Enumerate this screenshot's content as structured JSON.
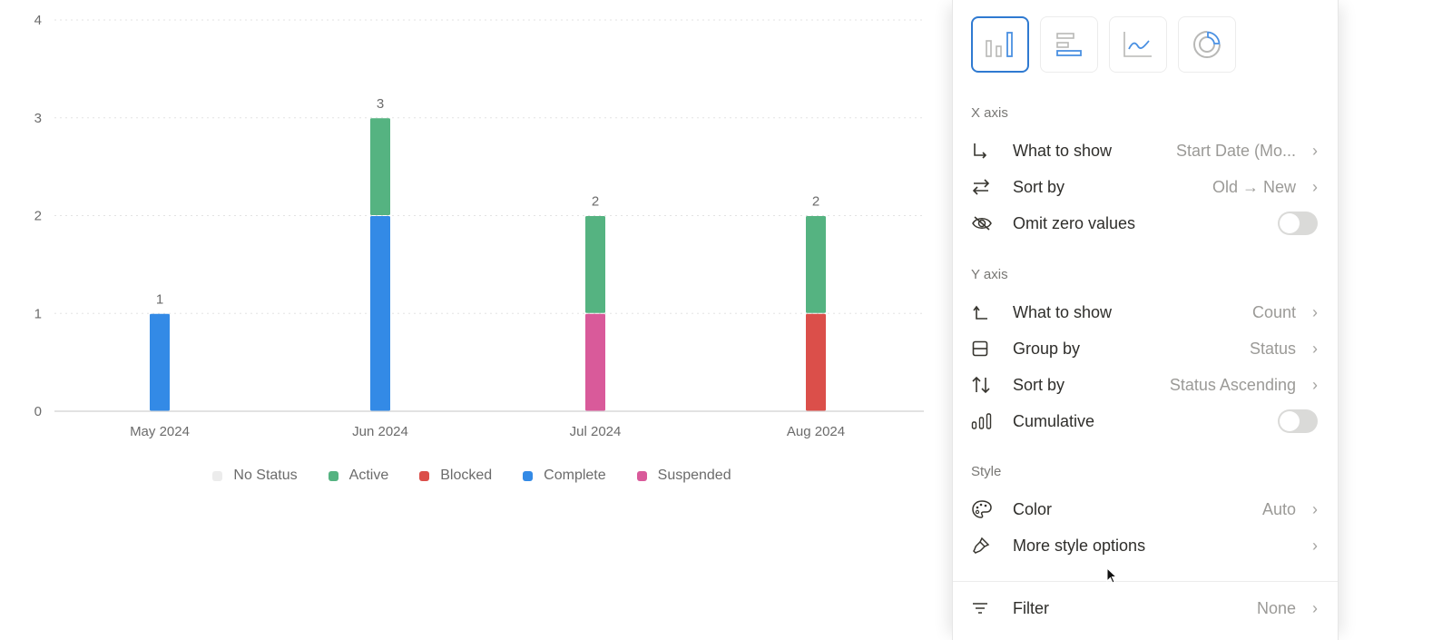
{
  "chart_data": {
    "type": "bar",
    "stacked": true,
    "title": "",
    "xlabel": "",
    "ylabel": "",
    "ylim": [
      0,
      4
    ],
    "yticks": [
      0,
      1,
      2,
      3,
      4
    ],
    "grid": true,
    "legend_position": "bottom",
    "categories": [
      "May 2024",
      "Jun 2024",
      "Jul 2024",
      "Aug 2024"
    ],
    "totals": [
      1,
      3,
      2,
      2
    ],
    "series": [
      {
        "name": "No Status",
        "color": "#ececec",
        "values": [
          0,
          0,
          0,
          0
        ]
      },
      {
        "name": "Active",
        "color": "#55b381",
        "values": [
          0,
          1,
          1,
          1
        ]
      },
      {
        "name": "Blocked",
        "color": "#db4f4a",
        "values": [
          0,
          0,
          0,
          1
        ]
      },
      {
        "name": "Complete",
        "color": "#338ae6",
        "values": [
          1,
          2,
          0,
          0
        ]
      },
      {
        "name": "Suspended",
        "color": "#d95a9a",
        "values": [
          0,
          0,
          1,
          0
        ]
      }
    ],
    "stack_order": [
      "Complete",
      "Suspended",
      "Blocked",
      "Active",
      "No Status"
    ]
  },
  "panel": {
    "chart_types": [
      {
        "name": "vertical-bar",
        "selected": true
      },
      {
        "name": "horizontal-bar",
        "selected": false
      },
      {
        "name": "line",
        "selected": false
      },
      {
        "name": "donut",
        "selected": false
      }
    ],
    "x_axis": {
      "title": "X axis",
      "what_to_show": {
        "label": "What to show",
        "value": "Start Date (Mo..."
      },
      "sort_by": {
        "label": "Sort by",
        "value": "Old → New"
      },
      "omit_zero": {
        "label": "Omit zero values",
        "on": false
      }
    },
    "y_axis": {
      "title": "Y axis",
      "what_to_show": {
        "label": "What to show",
        "value": "Count"
      },
      "group_by": {
        "label": "Group by",
        "value": "Status"
      },
      "sort_by": {
        "label": "Sort by",
        "value": "Status Ascending"
      },
      "cumulative": {
        "label": "Cumulative",
        "on": false
      }
    },
    "style": {
      "title": "Style",
      "color": {
        "label": "Color",
        "value": "Auto"
      },
      "more": {
        "label": "More style options",
        "value": ""
      }
    },
    "filter": {
      "label": "Filter",
      "value": "None"
    },
    "chevron": "›"
  }
}
